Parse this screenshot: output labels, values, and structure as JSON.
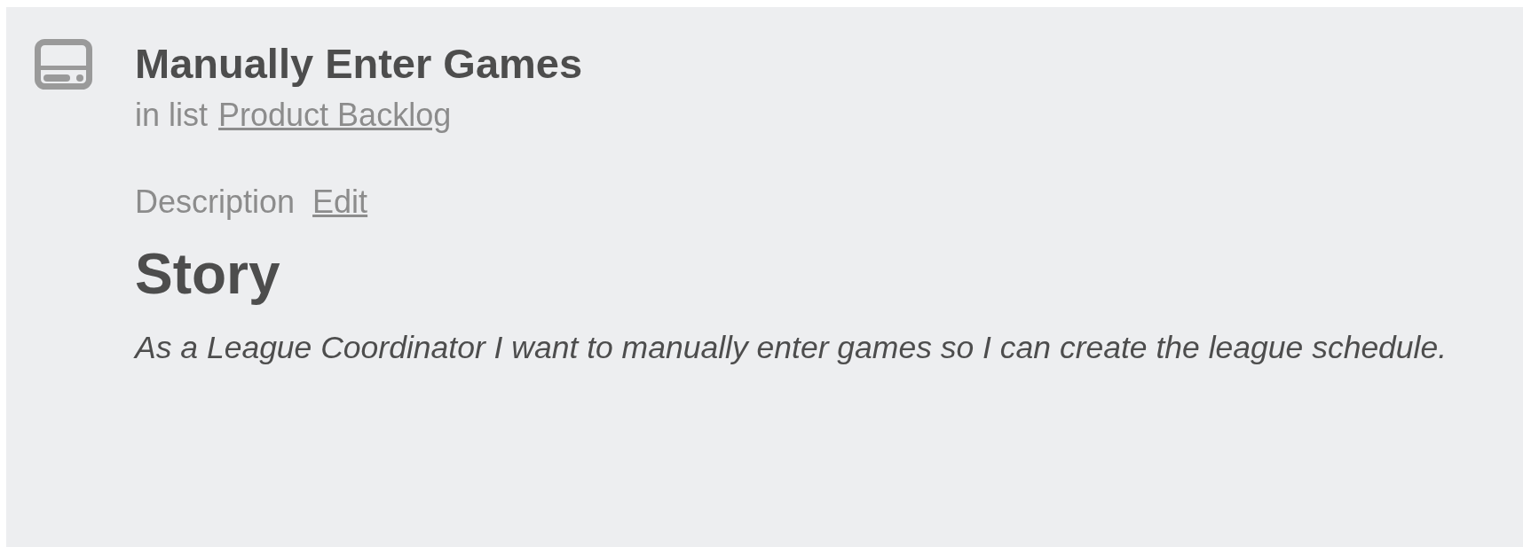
{
  "card": {
    "title": "Manually Enter Games",
    "list_prefix": "in list",
    "list_link": "Product Backlog"
  },
  "description": {
    "label": "Description",
    "edit_link": "Edit",
    "heading": "Story",
    "body": "As a League Coordinator I want to manually enter games so I can create the league schedule."
  }
}
